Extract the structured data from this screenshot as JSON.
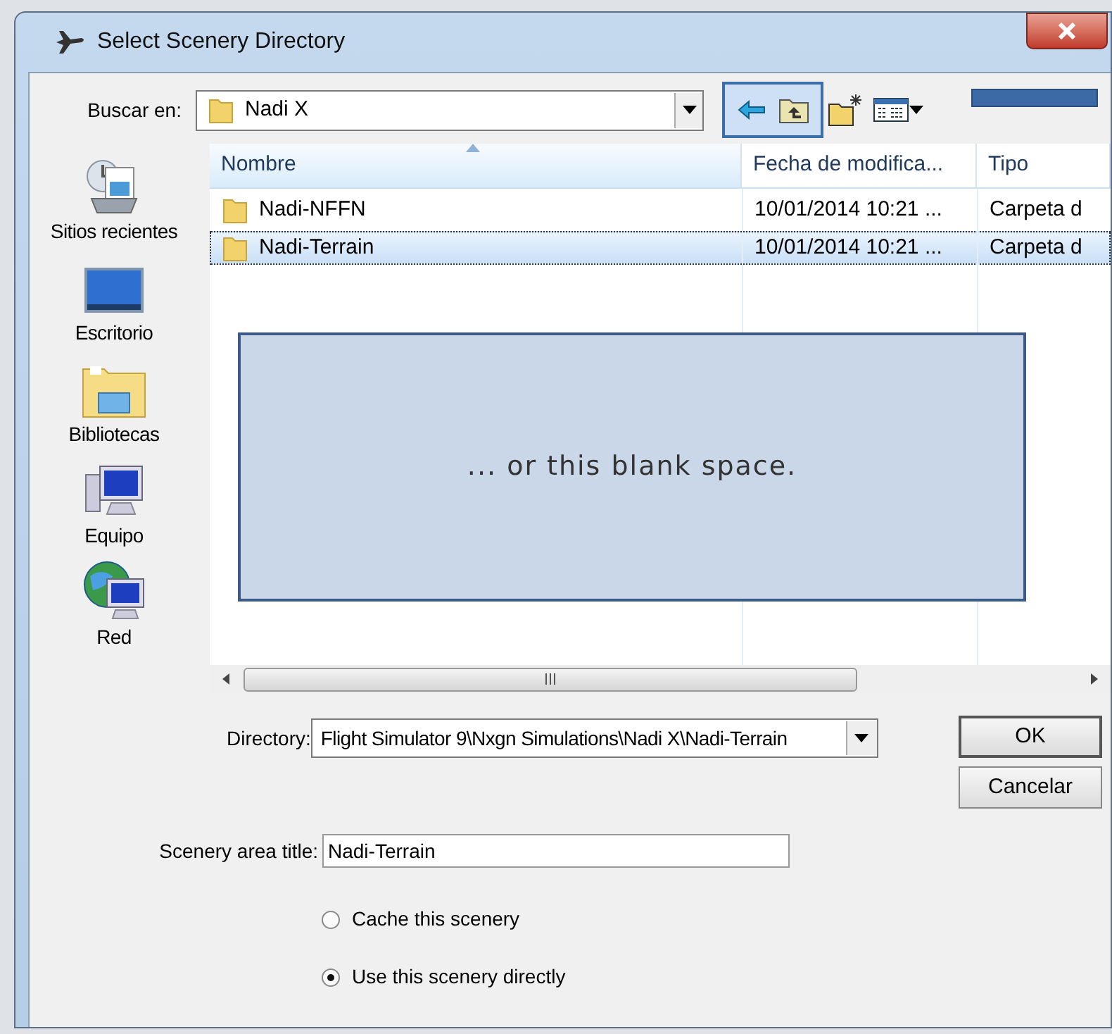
{
  "window": {
    "title": "Select Scenery Directory"
  },
  "look_in": {
    "label": "Buscar en:",
    "value": "Nadi X"
  },
  "places": [
    {
      "label": "Sitios recientes",
      "kind": "recent"
    },
    {
      "label": "Escritorio",
      "kind": "desktop"
    },
    {
      "label": "Bibliotecas",
      "kind": "libraries"
    },
    {
      "label": "Equipo",
      "kind": "computer"
    },
    {
      "label": "Red",
      "kind": "network"
    }
  ],
  "file_list": {
    "columns": [
      {
        "label": "Nombre",
        "sorted": true
      },
      {
        "label": "Fecha de modifica...",
        "sorted": false
      },
      {
        "label": "Tipo",
        "sorted": false
      }
    ],
    "rows": [
      {
        "name": "Nadi-NFFN",
        "date": "10/01/2014 10:21 ...",
        "type": "Carpeta d",
        "selected": false
      },
      {
        "name": "Nadi-Terrain",
        "date": "10/01/2014 10:21 ...",
        "type": "Carpeta d",
        "selected": true
      }
    ]
  },
  "annotation": {
    "text": "... or this blank space."
  },
  "directory": {
    "label": "Directory:",
    "value": "Flight Simulator 9\\Nxgn Simulations\\Nadi X\\Nadi-Terrain"
  },
  "buttons": [
    "OK",
    "Cancelar"
  ],
  "scenery_title": {
    "label": "Scenery area title:",
    "value": "Nadi-Terrain"
  },
  "options": [
    {
      "label": "Cache this scenery",
      "selected": false
    },
    {
      "label": "Use this scenery directly",
      "selected": true
    }
  ]
}
